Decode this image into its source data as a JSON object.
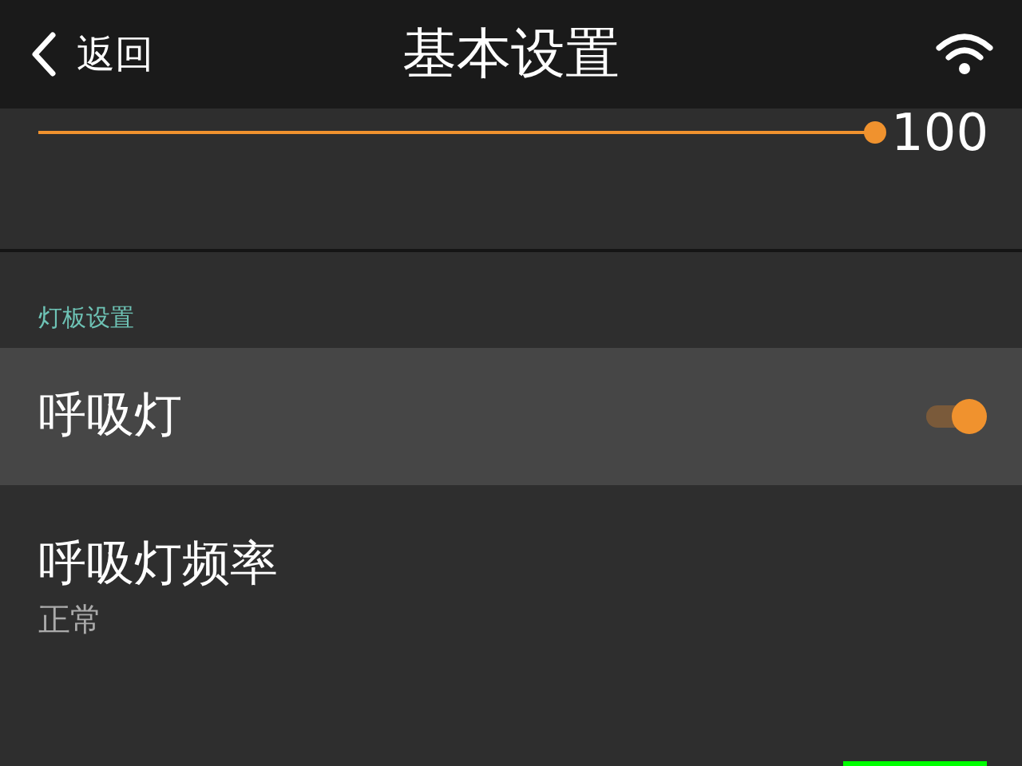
{
  "header": {
    "back_label": "返回",
    "title": "基本设置"
  },
  "brightness": {
    "level": 1.0,
    "reading": "100"
  },
  "section": {
    "title": "灯板设置"
  },
  "settings": [
    {
      "kind": "toggle",
      "label": "呼吸灯",
      "on": true,
      "selected": true
    },
    {
      "kind": "value",
      "label": "呼吸灯频率",
      "value": "正常",
      "selected": false
    },
    {
      "kind": "color",
      "color": "#00ff00",
      "selected": false
    }
  ]
}
